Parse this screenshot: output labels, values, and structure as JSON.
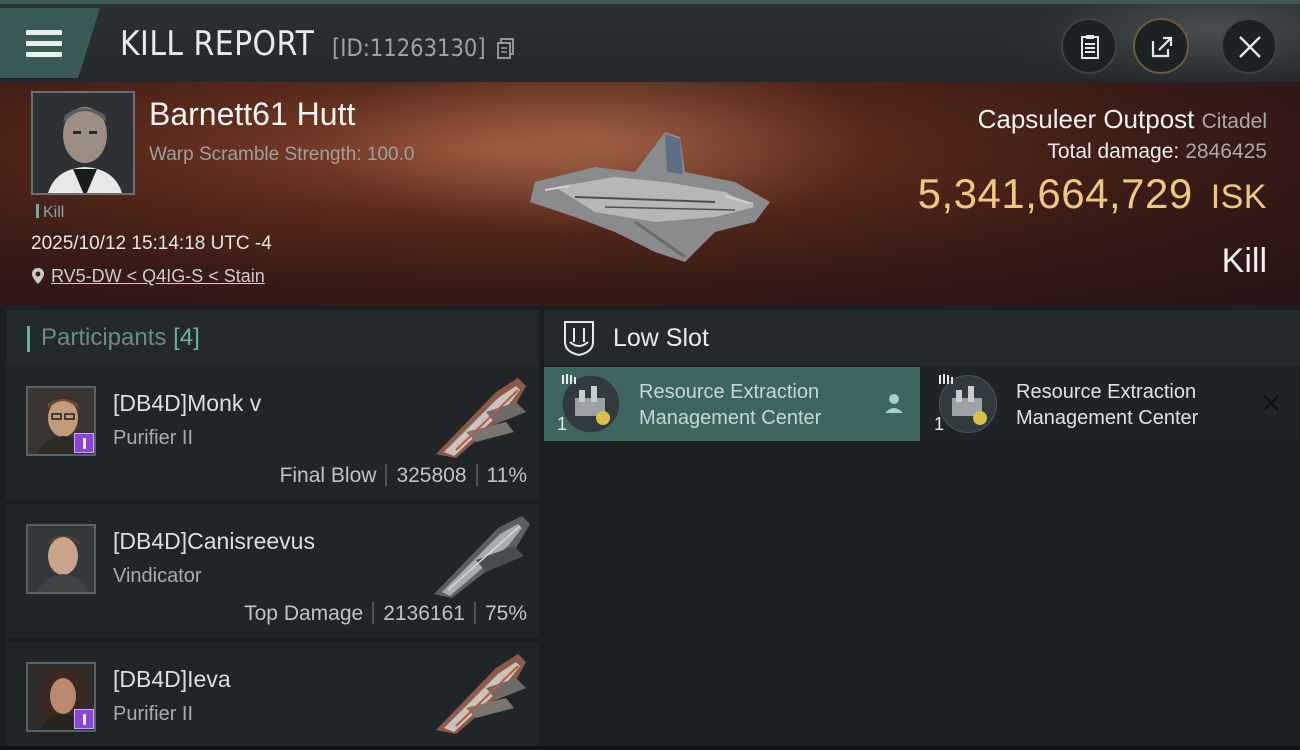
{
  "header": {
    "title": "KILL REPORT",
    "report_id": "[ID:11263130]",
    "buttons": [
      "clipboard-icon",
      "share-icon",
      "close-icon"
    ]
  },
  "victim": {
    "name": "Barnett61 Hutt",
    "subtitle": "Warp Scramble Strength: 100.0",
    "tag": "Kill",
    "timestamp": "2025/10/12 15:14:18 UTC -4",
    "location": "RV5-DW < Q4IG-S < Stain"
  },
  "target": {
    "name": "Capsuleer Outpost",
    "class": "Citadel",
    "total_damage_label": "Total damage:",
    "total_damage": "2846425",
    "value": "5,341,664,729",
    "currency": "ISK",
    "result": "Kill"
  },
  "participants": {
    "label": "Participants",
    "count": "[4]",
    "items": [
      {
        "name": "[DB4D]Monk v",
        "ship": "Purifier II",
        "role": "Final Blow",
        "damage": "325808",
        "percent": "11%"
      },
      {
        "name": "[DB4D]Canisreevus",
        "ship": "Vindicator",
        "role": "Top Damage",
        "damage": "2136161",
        "percent": "75%"
      },
      {
        "name": "[DB4D]Ieva",
        "ship": "Purifier II",
        "role": "",
        "damage": "",
        "percent": ""
      }
    ]
  },
  "slots": {
    "title": "Low Slot",
    "items": [
      {
        "qty": "1",
        "name_line1": "Resource Extraction",
        "name_line2": "Management Center",
        "status": "user-icon"
      },
      {
        "qty": "1",
        "name_line1": "Resource Extraction",
        "name_line2": "Management Center",
        "status": "close-icon"
      }
    ]
  },
  "colors": {
    "accent": "#6bb0a8",
    "isk": "#f0c77e",
    "selected_item": "#3d6660",
    "badge": "#8a45d6"
  }
}
